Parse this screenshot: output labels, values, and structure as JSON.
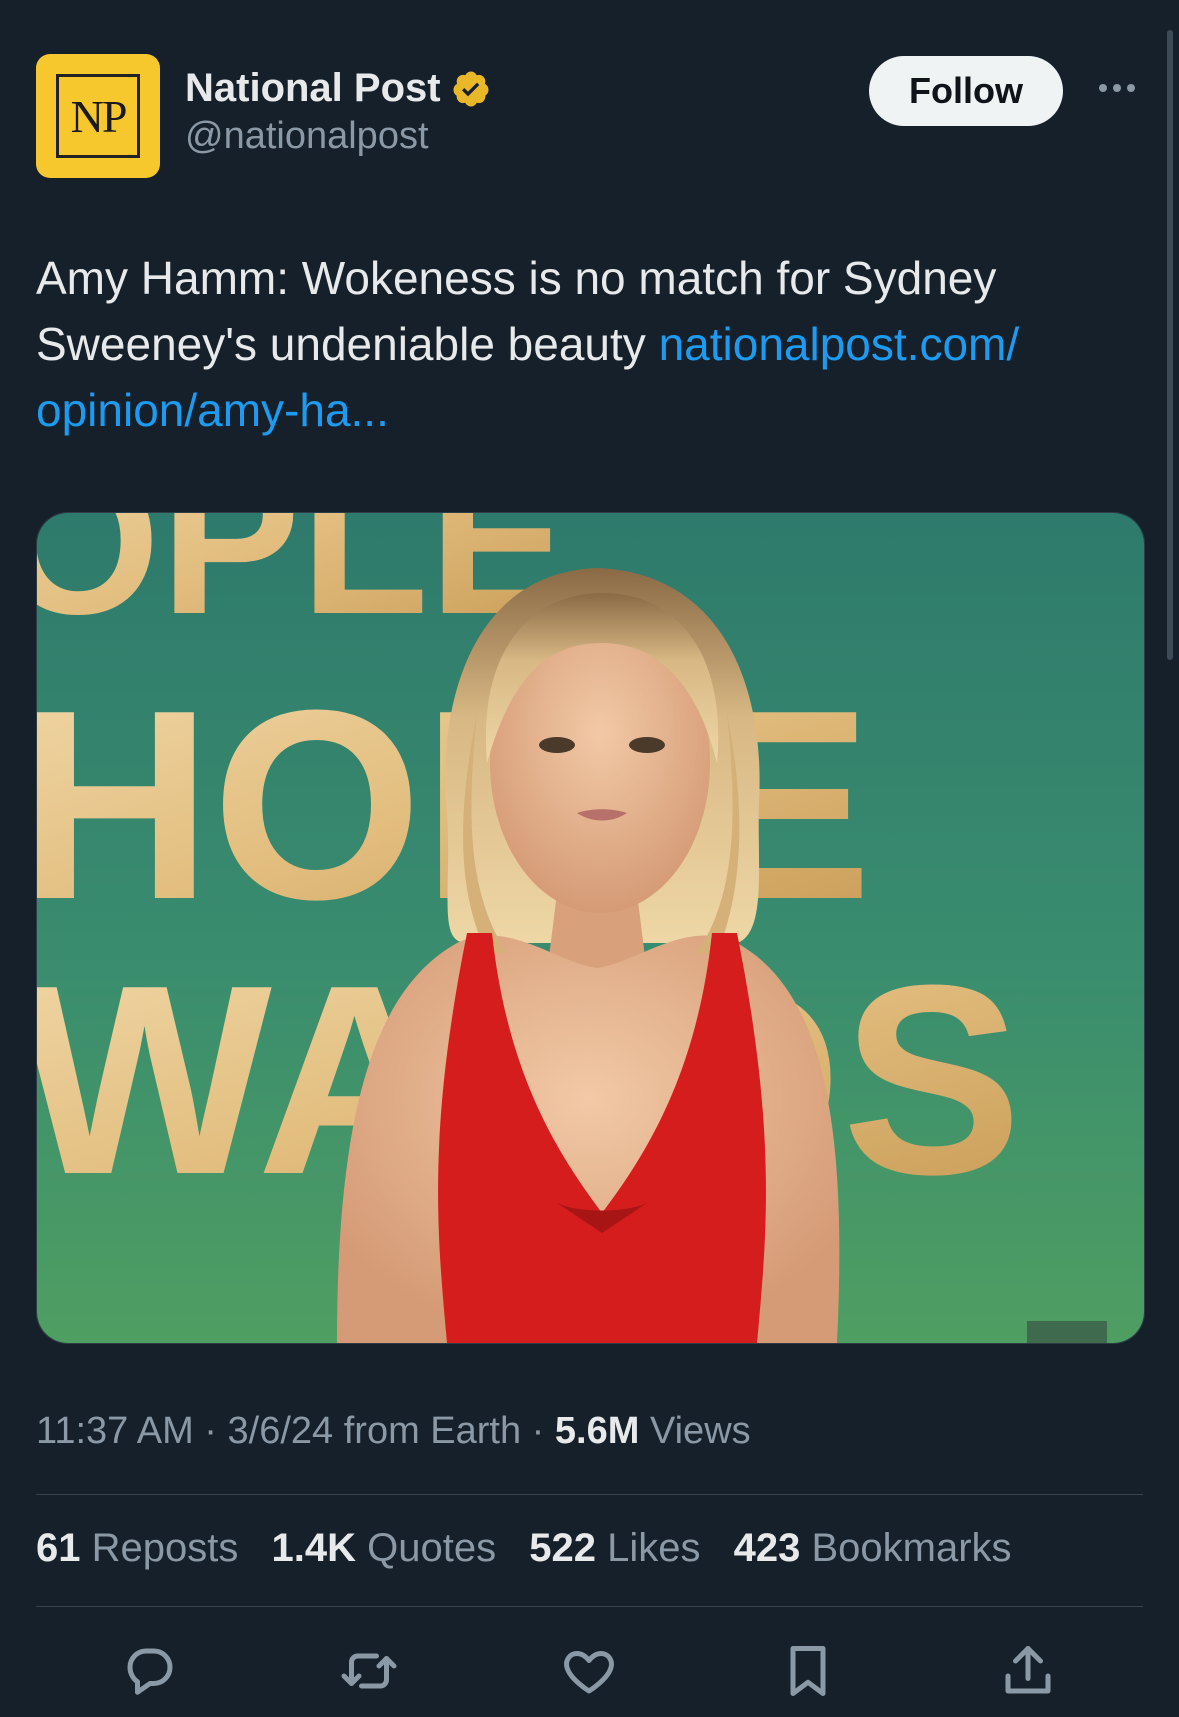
{
  "account": {
    "display_name": "National Post",
    "handle": "@nationalpost",
    "avatar_text": "NP",
    "follow_label": "Follow"
  },
  "tweet": {
    "text": "Amy Hamm: Wokeness is no match for Sydney Sweeney's undeniable beauty ",
    "link_text": "nationalpost.com/ opinion/amy-ha..."
  },
  "media": {
    "background_sign_text": [
      "OPLE",
      "HOICE",
      "WARDS"
    ]
  },
  "meta": {
    "time": "11:37 AM",
    "date": "3/6/24",
    "location": "from Earth",
    "views_count": "5.6M",
    "views_label": "Views"
  },
  "stats": {
    "reposts_count": "61",
    "reposts_label": "Reposts",
    "quotes_count": "1.4K",
    "quotes_label": "Quotes",
    "likes_count": "522",
    "likes_label": "Likes",
    "bookmarks_count": "423",
    "bookmarks_label": "Bookmarks"
  },
  "actions": [
    "reply-icon",
    "repost-icon",
    "like-icon",
    "bookmark-icon",
    "share-icon"
  ],
  "colors": {
    "background": "#15202b",
    "link": "#1d9bf0",
    "verified": "#e8b829",
    "muted": "#8b98a5",
    "text": "#e7e9ea"
  }
}
